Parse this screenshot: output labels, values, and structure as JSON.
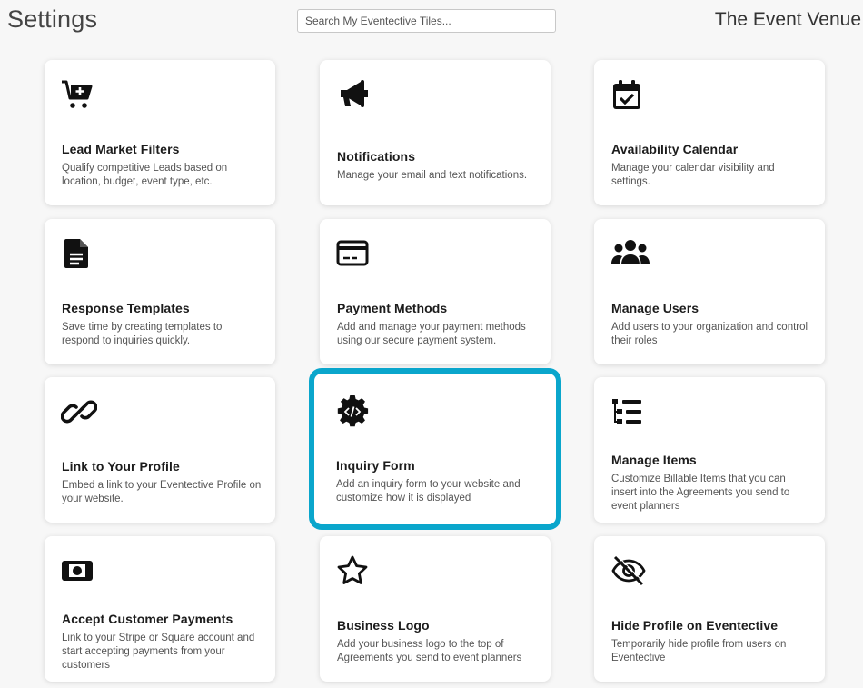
{
  "header": {
    "title": "Settings",
    "search_placeholder": "Search My Eventective Tiles...",
    "venue_name": "The Event Venue"
  },
  "tiles": [
    {
      "icon": "cart-plus-icon",
      "title": "Lead Market Filters",
      "desc": "Qualify competitive Leads based on location, budget, event type, etc."
    },
    {
      "icon": "megaphone-icon",
      "title": "Notifications",
      "desc": "Manage your email and text notifications."
    },
    {
      "icon": "calendar-check-icon",
      "title": "Availability Calendar",
      "desc": "Manage your calendar visibility and settings."
    },
    {
      "icon": "file-lines-icon",
      "title": "Response Templates",
      "desc": "Save time by creating templates to respond to inquiries quickly."
    },
    {
      "icon": "credit-card-icon",
      "title": "Payment Methods",
      "desc": "Add and manage your payment methods using our secure payment system."
    },
    {
      "icon": "users-icon",
      "title": "Manage Users",
      "desc": "Add users to your organization and control their roles"
    },
    {
      "icon": "link-icon",
      "title": "Link to Your Profile",
      "desc": "Embed a link to your Eventective Profile on your website."
    },
    {
      "icon": "code-gear-icon",
      "title": "Inquiry Form",
      "desc": "Add an inquiry form to your website and customize how it is displayed",
      "highlight_color": "#0aa6cc"
    },
    {
      "icon": "list-tree-icon",
      "title": "Manage Items",
      "desc": "Customize Billable Items that you can insert into the Agreements you send to event planners"
    },
    {
      "icon": "money-bill-icon",
      "title": "Accept Customer Payments",
      "desc": "Link to your Stripe or Square account and start accepting payments from your customers"
    },
    {
      "icon": "star-icon",
      "title": "Business Logo",
      "desc": "Add your business logo to the top of Agreements you send to event planners"
    },
    {
      "icon": "eye-slash-icon",
      "title": "Hide Profile on Eventective",
      "desc": "Temporarily hide profile from users on Eventective"
    }
  ]
}
